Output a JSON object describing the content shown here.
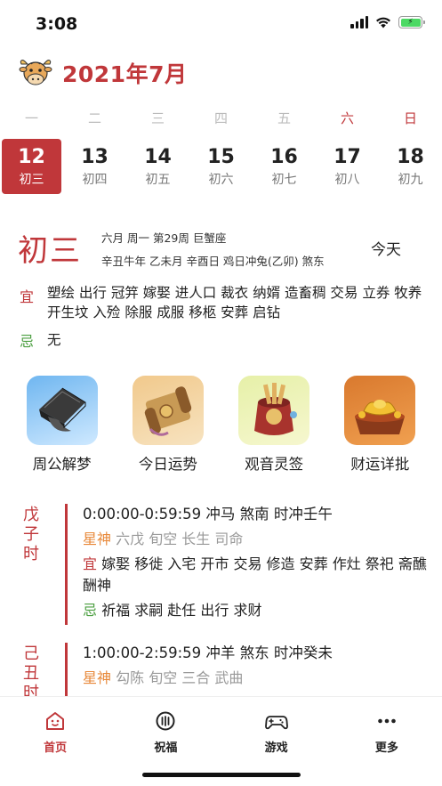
{
  "status": {
    "time": "3:08"
  },
  "header": {
    "title": "2021年7月"
  },
  "weekdays": [
    "一",
    "二",
    "三",
    "四",
    "五",
    "六",
    "日"
  ],
  "dates": [
    {
      "day": "12",
      "lunar": "初三"
    },
    {
      "day": "13",
      "lunar": "初四"
    },
    {
      "day": "14",
      "lunar": "初五"
    },
    {
      "day": "15",
      "lunar": "初六"
    },
    {
      "day": "16",
      "lunar": "初七"
    },
    {
      "day": "17",
      "lunar": "初八"
    },
    {
      "day": "18",
      "lunar": "初九"
    }
  ],
  "day": {
    "lunar_big": "初三",
    "line1": "六月 周一 第29周 巨蟹座",
    "line2": "辛丑牛年 乙未月 辛酉日 鸡日冲兔(乙卯) 煞东",
    "today_label": "今天",
    "yi_label": "宜",
    "yi_text": "塑绘 出行 冠笄 嫁娶 进人口 裁衣 纳婿 造畜稠 交易 立券 牧养 开生坟 入殓 除服 成服 移柩 安葬 启钻",
    "ji_label": "忌",
    "ji_text": "无"
  },
  "apps": [
    {
      "label": "周公解梦",
      "icon": "dream-icon"
    },
    {
      "label": "今日运势",
      "icon": "fortune-scroll-icon"
    },
    {
      "label": "观音灵签",
      "icon": "lot-bag-icon"
    },
    {
      "label": "财运详批",
      "icon": "gold-ingot-icon"
    }
  ],
  "hours": [
    {
      "name": "戊子时",
      "name_chars": [
        "戊",
        "子",
        "时"
      ],
      "head": "0:00:00-0:59:59  冲马  煞南  时冲壬午",
      "star_label": "星神",
      "star_text": "六戊 旬空 长生 司命",
      "yi_label": "宜",
      "yi_text": "嫁娶 移徙 入宅 开市 交易 修造 安葬 作灶 祭祀 斋醮 酬神",
      "ji_label": "忌",
      "ji_text": "祈福 求嗣 赴任 出行 求财"
    },
    {
      "name": "己丑时",
      "name_chars": [
        "己",
        "丑",
        "时"
      ],
      "head": "1:00:00-2:59:59  冲羊  煞东  时冲癸未",
      "star_label": "星神",
      "star_text": "勾陈 旬空 三合 武曲"
    }
  ],
  "tabs": [
    {
      "label": "首页",
      "icon": "home-icon",
      "active": true
    },
    {
      "label": "祝福",
      "icon": "blessing-icon",
      "active": false
    },
    {
      "label": "游戏",
      "icon": "gamepad-icon",
      "active": false
    },
    {
      "label": "更多",
      "icon": "more-icon",
      "active": false
    }
  ],
  "colors": {
    "accent": "#c0373a",
    "green": "#4a9e3f",
    "orange": "#e8893a"
  }
}
